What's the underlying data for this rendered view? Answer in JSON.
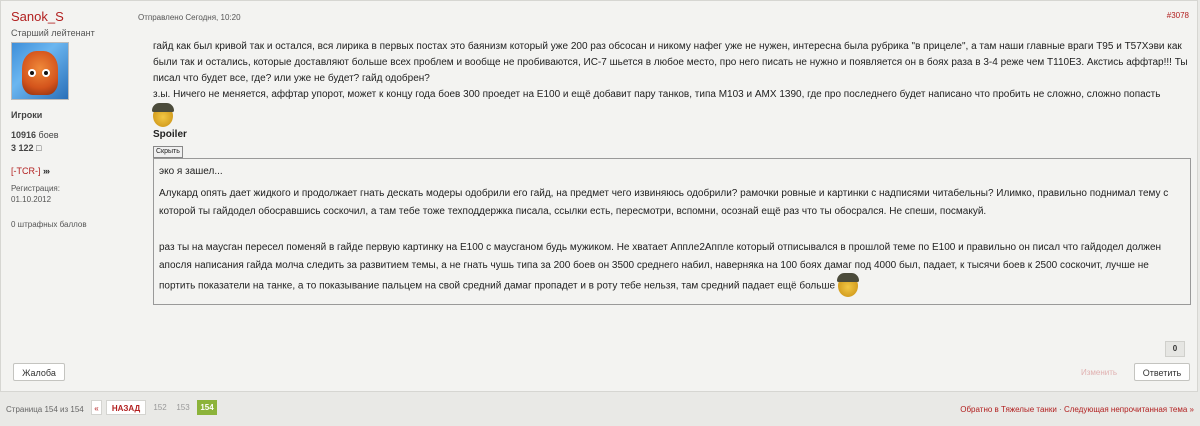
{
  "post": {
    "author": "Sanok_S",
    "rank": "Старший лейтенант",
    "group": "Игроки",
    "battles_count": "10916",
    "battles_label": "боев",
    "messages": "3 122",
    "clan": "[-TCR-]",
    "reg_label": "Регистрация:",
    "reg_date": "01.10.2012",
    "penalty": "0 штрафных баллов",
    "posted": "Отправлено Сегодня, 10:20",
    "number": "#3078",
    "body_1": "гайд как был кривой так и остался, вся лирика в первых постах это баянизм который уже 200 раз обсосан и никому нафег уже не нужен, интересна была рубрика \"в прицеле\", а там наши главные враги Т95 и Т57Хэви как были так и остались, которые доставляют больше всех проблем и вообще не пробиваются, ИС-7 шьется в любое место, про него писать не нужно и появляется он в боях раза в 3-4 реже чем T110E3. Акстись аффтар!!! Ты писал что будет все, где? или уже не будет? гайд одобрен?",
    "body_2": "з.ы. Ничего не меняется, аффтар упорот, может к концу года боев 300 проедет на Е100 и ещё добавит пару танков, типа M103 и AMX 1390, где про последнего будет написано что пробить не сложно, сложно попасть",
    "spoiler_title": "Spoiler",
    "spoiler_button": "Скрыть",
    "spoiler_1": "эко я зашел...",
    "spoiler_2": "Алукард опять дает жидкого и продолжает гнать дескать модеры одобрили его гайд, на предмет чего извиняюсь одобрили? рамочки ровные и картинки с надписями читабельны? Илимко, правильно поднимал тему с которой ты гайдодел обосравшись соскочил, а там тебе тоже техподдержка писала, ссылки есть, пересмотри, вспомни, осознай ещё раз что ты обосрался. Не спеши, посмакуй.",
    "spoiler_3": "раз ты на маусган пересел поменяй в гайде первую картинку на Е100 с маусганом будь мужиком. Не хватает Аппле2Аппле который отписывался в прошлой теме по Е100 и правильно он писал что гайдодел должен апосля написания гайда молча следить за развитием темы, а не гнать чушь типа за 200 боев он 3500 среднего набил, наверняка на 100 боях дамаг под 4000 был, падает, к тысячи боев к 2500 соскочит, лучше не портить показатели на танке, а то показывание пальцем на свой средний дамаг пропадет и в роту тебе нельзя, там средний падает ещё больше",
    "likes": "0",
    "report_label": "Жалоба",
    "edit_label": "Изменить",
    "reply_label": "Ответить"
  },
  "pagination": {
    "label": "Страница 154 из 154",
    "first": "«",
    "back": "НАЗАД",
    "pages": [
      "152",
      "153"
    ],
    "current": "154",
    "back_to_forum": "Обратно в Тяжелые танки",
    "separator": "·",
    "next_unread": "Следующая непрочитанная тема »"
  }
}
